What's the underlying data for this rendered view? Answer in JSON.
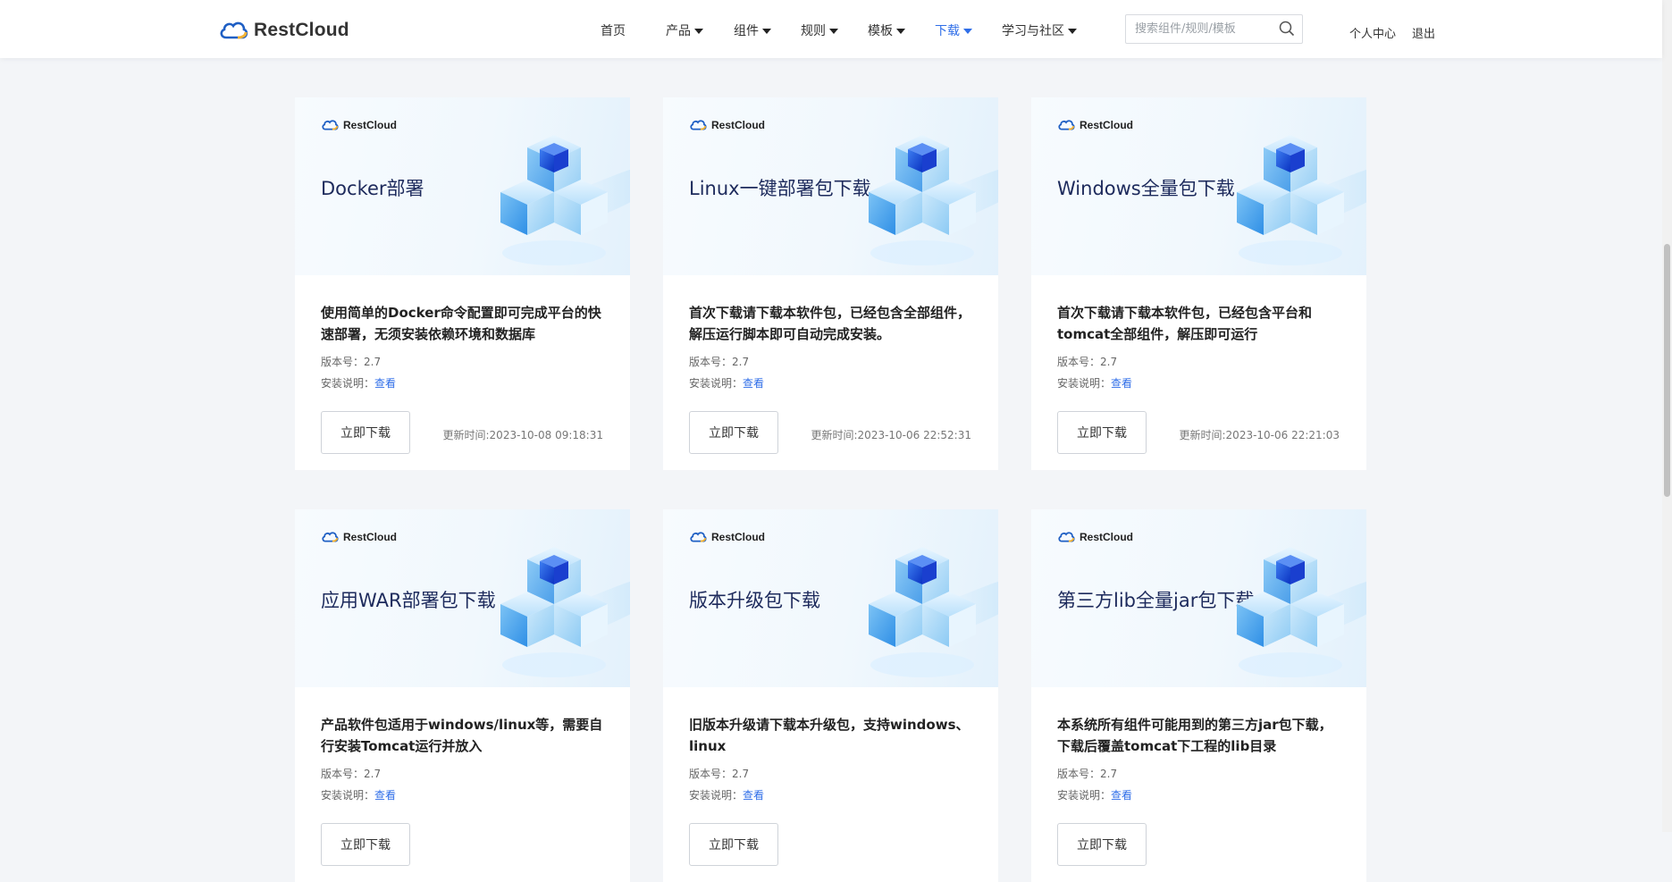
{
  "header": {
    "logo_text": "RestCloud",
    "nav": [
      {
        "label": "首页",
        "has_caret": false,
        "active": false
      },
      {
        "label": "产品",
        "has_caret": true,
        "active": false
      },
      {
        "label": "组件",
        "has_caret": true,
        "active": false
      },
      {
        "label": "规则",
        "has_caret": true,
        "active": false
      },
      {
        "label": "模板",
        "has_caret": true,
        "active": false
      },
      {
        "label": "下载",
        "has_caret": true,
        "active": true
      },
      {
        "label": "学习与社区",
        "has_caret": true,
        "active": false
      }
    ],
    "search_placeholder": "搜索组件/规则/模板",
    "user_center": "个人中心",
    "logout": "退出"
  },
  "colors": {
    "accent": "#2f6ee8",
    "title": "#1d2a5c",
    "background": "#f3f5f8"
  },
  "cards": [
    {
      "brand": "RestCloud",
      "title": "Docker部署",
      "description": "使用简单的Docker命令配置即可完成平台的快速部署，无须安装依赖环境和数据库",
      "version_label": "版本号：",
      "version": "2.7",
      "install_label": "安装说明：",
      "install_link": "查看",
      "download_label": "立即下载",
      "update_label": "更新时间:",
      "update_time": "2023-10-08 09:18:31"
    },
    {
      "brand": "RestCloud",
      "title": "Linux一键部署包下载",
      "description": "首次下载请下载本软件包，已经包含全部组件，解压运行脚本即可自动完成安装。",
      "version_label": "版本号：",
      "version": "2.7",
      "install_label": "安装说明：",
      "install_link": "查看",
      "download_label": "立即下载",
      "update_label": "更新时间:",
      "update_time": "2023-10-06 22:52:31"
    },
    {
      "brand": "RestCloud",
      "title": "Windows全量包下载",
      "description": "首次下载请下载本软件包，已经包含平台和tomcat全部组件，解压即可运行",
      "version_label": "版本号：",
      "version": "2.7",
      "install_label": "安装说明：",
      "install_link": "查看",
      "download_label": "立即下载",
      "update_label": "更新时间:",
      "update_time": "2023-10-06 22:21:03"
    },
    {
      "brand": "RestCloud",
      "title": "应用WAR部署包下载",
      "description": "产品软件包适用于windows/linux等，需要自行安装Tomcat运行并放入",
      "version_label": "版本号：",
      "version": "2.7",
      "install_label": "安装说明：",
      "install_link": "查看",
      "download_label": "立即下载",
      "update_label": "",
      "update_time": ""
    },
    {
      "brand": "RestCloud",
      "title": "版本升级包下载",
      "description": "旧版本升级请下载本升级包，支持windows、linux",
      "version_label": "版本号：",
      "version": "2.7",
      "install_label": "安装说明：",
      "install_link": "查看",
      "download_label": "立即下载",
      "update_label": "",
      "update_time": ""
    },
    {
      "brand": "RestCloud",
      "title": "第三方lib全量jar包下载",
      "description": "本系统所有组件可能用到的第三方jar包下载，下载后覆盖tomcat下工程的lib目录",
      "version_label": "版本号：",
      "version": "2.7",
      "install_label": "安装说明：",
      "install_link": "查看",
      "download_label": "立即下载",
      "update_label": "",
      "update_time": ""
    }
  ]
}
